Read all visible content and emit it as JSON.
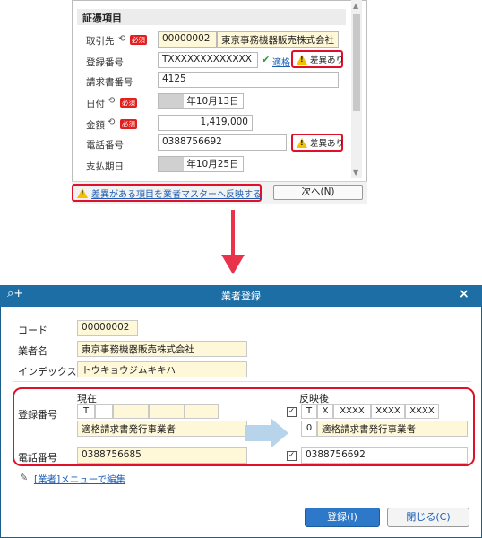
{
  "top": {
    "section_title": "証憑項目",
    "fields": {
      "vendor_label": "取引先",
      "vendor_code": "00000002",
      "vendor_name": "東京事務機器販売株式会社",
      "reg_label": "登録番号",
      "reg_value": "TXXXXXXXXXXXXX",
      "reg_check_link": "適格",
      "invoice_label": "請求書番号",
      "invoice_value": "4125",
      "date_label": "日付",
      "date_value": "年10月13日",
      "amount_label": "金額",
      "amount_value": "1,419,000",
      "phone_label": "電話番号",
      "phone_value": "0388756692",
      "due_label": "支払期日",
      "due_value": "年10月25日"
    },
    "required_badge": "必須",
    "diff_badge": "差異あり",
    "reflect_link": "差異がある項目を業者マスターへ反映する",
    "next_button": "次へ(N)"
  },
  "dialog": {
    "title": "業者登録",
    "code_label": "コード",
    "code_value": "00000002",
    "name_label": "業者名",
    "name_value": "東京事務機器販売株式会社",
    "index_label": "インデックス",
    "index_value": "トウキョウジムキキハ",
    "current_label": "現在",
    "after_label": "反映後",
    "reg_label": "登録番号",
    "current_reg_cells": [
      "T",
      "",
      "",
      "",
      "",
      ""
    ],
    "current_reg_desc": "適格請求書発行事業者",
    "after_reg_cells": [
      "T",
      "X",
      "XXXX",
      "XXXX",
      "XXXX"
    ],
    "after_reg_code": "0",
    "after_reg_desc": "適格請求書発行事業者",
    "phone_label": "電話番号",
    "current_phone": "0388756685",
    "after_phone": "0388756692",
    "edit_link": "[業者]メニューで編集",
    "register_button": "登録(I)",
    "close_button": "閉じる(C)"
  },
  "colors": {
    "accent_red": "#e0102a",
    "title_blue": "#1e6ea6",
    "field_yellow": "#fff8d8"
  }
}
